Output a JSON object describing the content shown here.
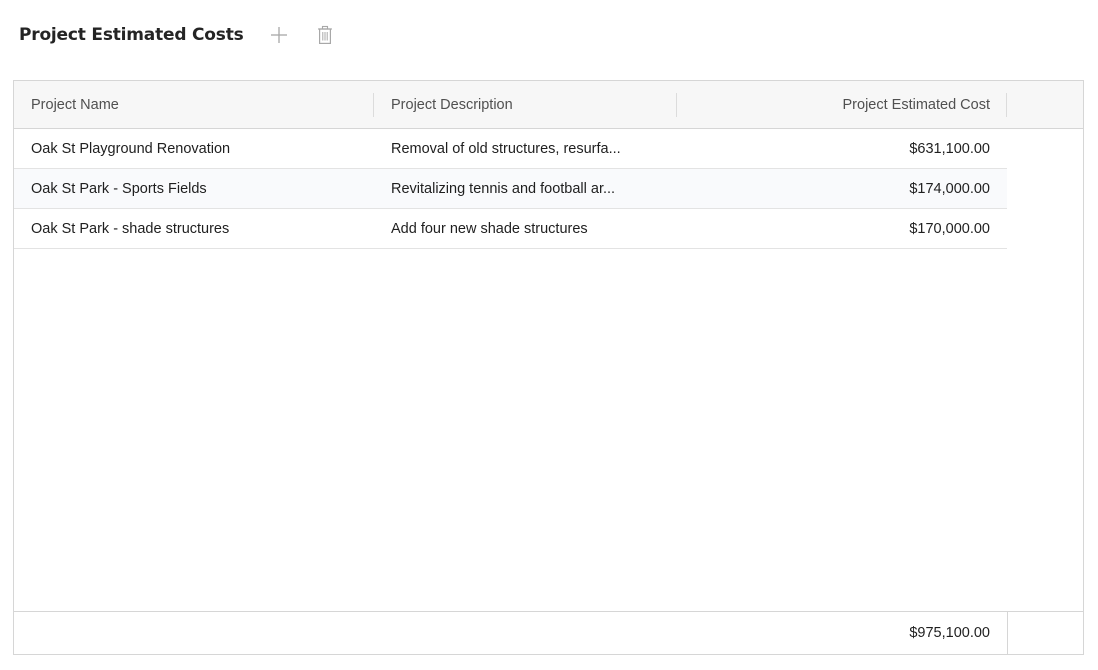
{
  "header": {
    "title": "Project Estimated Costs",
    "add_icon": "plus-icon",
    "delete_icon": "trash-icon"
  },
  "grid": {
    "columns": [
      {
        "label": "Project Name"
      },
      {
        "label": "Project Description"
      },
      {
        "label": "Project Estimated Cost"
      }
    ],
    "rows": [
      {
        "name": "Oak St Playground Renovation",
        "description": "Removal of old structures, resurfa...",
        "cost": "$631,100.00"
      },
      {
        "name": "Oak St Park - Sports Fields",
        "description": "Revitalizing tennis and football ar...",
        "cost": "$174,000.00"
      },
      {
        "name": "Oak St Park - shade structures",
        "description": "Add four new shade structures",
        "cost": "$170,000.00"
      }
    ],
    "footer": {
      "total": "$975,100.00"
    }
  },
  "colors": {
    "header_bg": "#f7f7f7",
    "border": "#d6d6d6",
    "icon": "#9a9a9a"
  }
}
